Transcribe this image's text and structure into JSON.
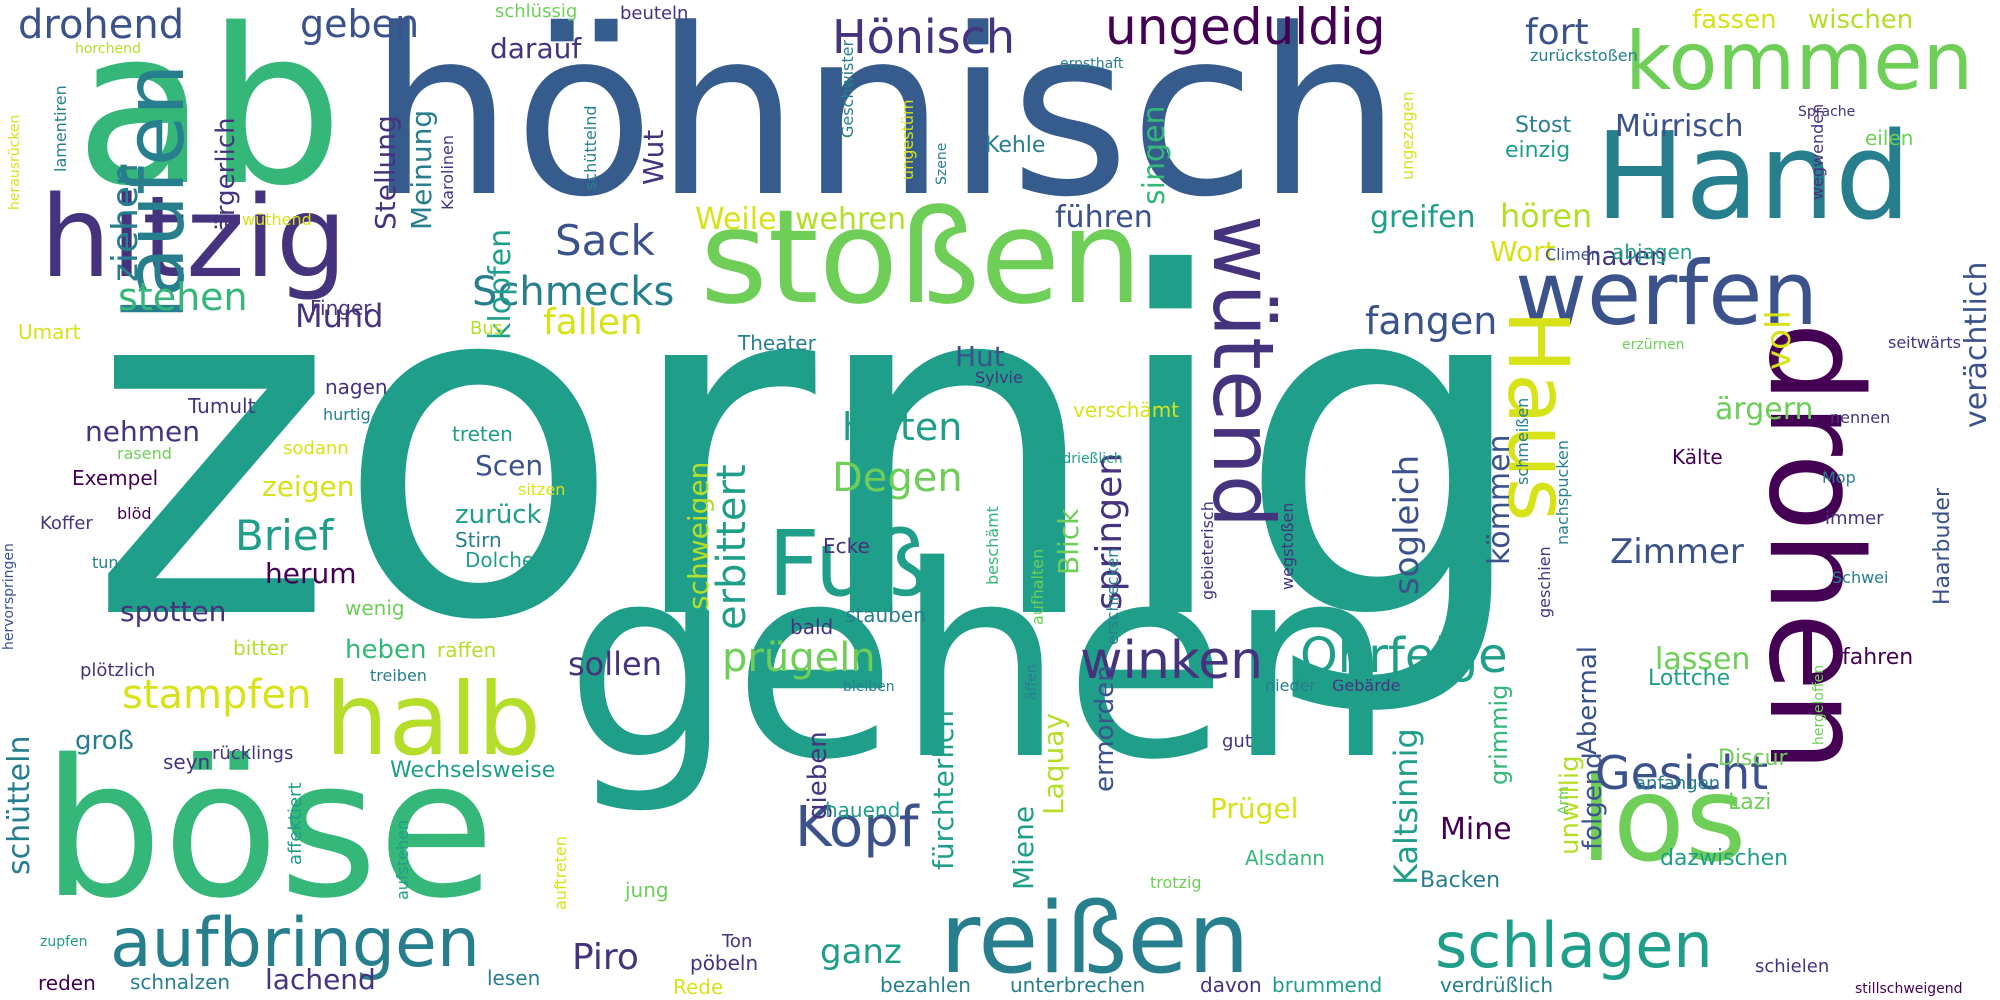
{
  "palette": {
    "deep_purple": "#440154",
    "indigo": "#46337e",
    "blue": "#365c8d",
    "steel": "#3b528b",
    "teal_blue": "#277f8e",
    "teal": "#1f9e89",
    "green": "#35b779",
    "light_green": "#6ece58",
    "lime": "#b5de2b",
    "yellow": "#d8e219"
  },
  "words": [
    {
      "text": "zornig",
      "color": "teal"
    },
    {
      "text": "gehen",
      "color": "teal"
    },
    {
      "text": "höhnisch",
      "color": "blue"
    },
    {
      "text": "ab",
      "color": "green"
    },
    {
      "text": "böse",
      "color": "green"
    },
    {
      "text": "drohen",
      "color": "deep_purple"
    },
    {
      "text": "stoßen",
      "color": "light_green"
    },
    {
      "text": "Hand",
      "color": "teal_blue"
    },
    {
      "text": "hitzig",
      "color": "indigo"
    },
    {
      "text": "los",
      "color": "light_green"
    },
    {
      "text": "reißen",
      "color": "teal_blue"
    },
    {
      "text": "Fuß",
      "color": "teal"
    },
    {
      "text": "halb",
      "color": "lime"
    },
    {
      "text": "laufen",
      "color": "teal_blue"
    },
    {
      "text": "werfen",
      "color": "steel"
    },
    {
      "text": "kommen",
      "color": "light_green"
    },
    {
      "text": "wütend",
      "color": "indigo"
    },
    {
      "text": "Haus",
      "color": "yellow"
    },
    {
      "text": "aufbringen",
      "color": "teal_blue"
    },
    {
      "text": "schlagen",
      "color": "teal"
    },
    {
      "text": "Hönisch",
      "color": "indigo"
    },
    {
      "text": "ungeduldig",
      "color": "deep_purple"
    },
    {
      "text": "Kopf",
      "color": "steel"
    },
    {
      "text": "winken",
      "color": "indigo"
    },
    {
      "text": "Ohrfeige",
      "color": "teal"
    },
    {
      "text": "Gesicht",
      "color": "steel"
    },
    {
      "text": "erbittert",
      "color": "teal"
    },
    {
      "text": "Sack",
      "color": "steel"
    },
    {
      "text": "Schmecks",
      "color": "teal_blue"
    },
    {
      "text": "prügeln",
      "color": "light_green"
    },
    {
      "text": "stampfen",
      "color": "yellow"
    },
    {
      "text": "drohend",
      "color": "steel"
    },
    {
      "text": "Degen",
      "color": "light_green"
    },
    {
      "text": "halten",
      "color": "teal"
    },
    {
      "text": "fangen",
      "color": "steel"
    },
    {
      "text": "sollen",
      "color": "indigo"
    },
    {
      "text": "Brief",
      "color": "teal"
    },
    {
      "text": "Piro",
      "color": "indigo"
    },
    {
      "text": "ganz",
      "color": "teal"
    },
    {
      "text": "springen",
      "color": "indigo"
    },
    {
      "text": "Zimmer",
      "color": "steel"
    },
    {
      "text": "sogleich",
      "color": "steel"
    },
    {
      "text": "Kaltsinnig",
      "color": "teal"
    },
    {
      "text": "kömmen",
      "color": "steel"
    },
    {
      "text": "Mürrisch",
      "color": "steel"
    },
    {
      "text": "voll",
      "color": "yellow"
    },
    {
      "text": "verächtlich",
      "color": "steel"
    },
    {
      "text": "hören",
      "color": "lime"
    },
    {
      "text": "greifen",
      "color": "teal"
    },
    {
      "text": "Mund",
      "color": "indigo"
    },
    {
      "text": "stehen",
      "color": "green"
    },
    {
      "text": "fallen",
      "color": "yellow"
    },
    {
      "text": "ziehen",
      "color": "teal_blue"
    },
    {
      "text": "geben",
      "color": "steel"
    },
    {
      "text": "fort",
      "color": "steel"
    },
    {
      "text": "fassen",
      "color": "yellow"
    },
    {
      "text": "wischen",
      "color": "lime"
    },
    {
      "text": "Weile",
      "color": "yellow"
    },
    {
      "text": "wehren",
      "color": "lime"
    },
    {
      "text": "führen",
      "color": "steel"
    },
    {
      "text": "Wut",
      "color": "indigo"
    },
    {
      "text": "darauf",
      "color": "indigo"
    },
    {
      "text": "singen",
      "color": "green"
    },
    {
      "text": "Meinung",
      "color": "teal_blue"
    },
    {
      "text": "Stellung",
      "color": "indigo"
    },
    {
      "text": "klopfen",
      "color": "teal"
    },
    {
      "text": "ärgerlich",
      "color": "indigo"
    },
    {
      "text": "Hut",
      "color": "steel"
    },
    {
      "text": "Scen",
      "color": "steel"
    },
    {
      "text": "zurück",
      "color": "teal"
    },
    {
      "text": "herum",
      "color": "deep_purple"
    },
    {
      "text": "zeigen",
      "color": "yellow"
    },
    {
      "text": "nehmen",
      "color": "indigo"
    },
    {
      "text": "spotten",
      "color": "indigo"
    },
    {
      "text": "heben",
      "color": "green"
    },
    {
      "text": "lassen",
      "color": "light_green"
    },
    {
      "text": "Lottche",
      "color": "teal"
    },
    {
      "text": "fahren",
      "color": "deep_purple"
    },
    {
      "text": "Mine",
      "color": "deep_purple"
    },
    {
      "text": "Prügel",
      "color": "yellow"
    },
    {
      "text": "ärgern",
      "color": "light_green"
    },
    {
      "text": "hauen",
      "color": "indigo"
    },
    {
      "text": "Wort",
      "color": "yellow"
    },
    {
      "text": "schütteln",
      "color": "teal_blue"
    },
    {
      "text": "groß",
      "color": "teal_blue"
    },
    {
      "text": "lachend",
      "color": "indigo"
    },
    {
      "text": "schweigen",
      "color": "lime"
    },
    {
      "text": "Blick",
      "color": "light_green"
    },
    {
      "text": "fürchterlich",
      "color": "teal"
    },
    {
      "text": "Miene",
      "color": "teal"
    },
    {
      "text": "Laquay",
      "color": "lime"
    },
    {
      "text": "gieben",
      "color": "indigo"
    },
    {
      "text": "ermorden",
      "color": "steel"
    },
    {
      "text": "grimmig",
      "color": "green"
    },
    {
      "text": "Abermal",
      "color": "steel"
    },
    {
      "text": "unwillig",
      "color": "lime"
    },
    {
      "text": "folgend",
      "color": "steel"
    },
    {
      "text": "Wechselsweise",
      "color": "teal"
    },
    {
      "text": "Backen",
      "color": "teal_blue"
    },
    {
      "text": "Alsdann",
      "color": "green"
    },
    {
      "text": "dazwischen",
      "color": "teal"
    },
    {
      "text": "Discur",
      "color": "light_green"
    },
    {
      "text": "Lazi",
      "color": "light_green"
    },
    {
      "text": "Haarbuder",
      "color": "steel"
    },
    {
      "text": "Stost",
      "color": "teal_blue"
    },
    {
      "text": "einzig",
      "color": "teal"
    },
    {
      "text": "Kehle",
      "color": "teal_blue"
    },
    {
      "text": "Finger",
      "color": "indigo"
    },
    {
      "text": "Umart",
      "color": "yellow"
    },
    {
      "text": "Bus",
      "color": "lime"
    },
    {
      "text": "Theater",
      "color": "teal_blue"
    },
    {
      "text": "verschämt",
      "color": "yellow"
    },
    {
      "text": "Tumult",
      "color": "indigo"
    },
    {
      "text": "nagen",
      "color": "indigo"
    },
    {
      "text": "hurtig",
      "color": "teal_blue"
    },
    {
      "text": "treten",
      "color": "teal"
    },
    {
      "text": "sodann",
      "color": "yellow"
    },
    {
      "text": "Exempel",
      "color": "deep_purple"
    },
    {
      "text": "rasend",
      "color": "light_green"
    },
    {
      "text": "sitzen",
      "color": "yellow"
    },
    {
      "text": "Stirn",
      "color": "teal_blue"
    },
    {
      "text": "Dolche",
      "color": "teal"
    },
    {
      "text": "Ecke",
      "color": "indigo"
    },
    {
      "text": "stauben",
      "color": "teal_blue"
    },
    {
      "text": "bald",
      "color": "indigo"
    },
    {
      "text": "Koffer",
      "color": "indigo"
    },
    {
      "text": "blöd",
      "color": "deep_purple"
    },
    {
      "text": "tun",
      "color": "teal_blue"
    },
    {
      "text": "wenig",
      "color": "light_green"
    },
    {
      "text": "bitter",
      "color": "lime"
    },
    {
      "text": "raffen",
      "color": "lime"
    },
    {
      "text": "plötzlich",
      "color": "indigo"
    },
    {
      "text": "treiben",
      "color": "teal_blue"
    },
    {
      "text": "rücklings",
      "color": "indigo"
    },
    {
      "text": "seyn",
      "color": "indigo"
    },
    {
      "text": "reden",
      "color": "deep_purple"
    },
    {
      "text": "schnalzen",
      "color": "teal_blue"
    },
    {
      "text": "lesen",
      "color": "teal_blue"
    },
    {
      "text": "Rede",
      "color": "yellow"
    },
    {
      "text": "Ton",
      "color": "indigo"
    },
    {
      "text": "pöbeln",
      "color": "indigo"
    },
    {
      "text": "jung",
      "color": "light_green"
    },
    {
      "text": "hauend",
      "color": "teal"
    },
    {
      "text": "bezahlen",
      "color": "teal_blue"
    },
    {
      "text": "unterbrechen",
      "color": "teal_blue"
    },
    {
      "text": "davon",
      "color": "indigo"
    },
    {
      "text": "brummend",
      "color": "teal"
    },
    {
      "text": "verdrüßlich",
      "color": "teal_blue"
    },
    {
      "text": "schielen",
      "color": "indigo"
    },
    {
      "text": "stillschweigend",
      "color": "deep_purple"
    },
    {
      "text": "trotzig",
      "color": "light_green"
    },
    {
      "text": "gut",
      "color": "indigo"
    },
    {
      "text": "nieder",
      "color": "teal_blue"
    },
    {
      "text": "Gebärde",
      "color": "indigo"
    },
    {
      "text": "anfangen",
      "color": "teal_blue"
    },
    {
      "text": "Kälte",
      "color": "deep_purple"
    },
    {
      "text": "Mop",
      "color": "teal_blue"
    },
    {
      "text": "immer",
      "color": "indigo"
    },
    {
      "text": "nennen",
      "color": "indigo"
    },
    {
      "text": "Schwei",
      "color": "teal_blue"
    },
    {
      "text": "Sylvie",
      "color": "indigo"
    },
    {
      "text": "verdrießlich",
      "color": "teal"
    },
    {
      "text": "erzürnen",
      "color": "light_green"
    },
    {
      "text": "seitwärts",
      "color": "indigo"
    },
    {
      "text": "abjagen",
      "color": "teal"
    },
    {
      "text": "Climen",
      "color": "steel"
    },
    {
      "text": "eilen",
      "color": "light_green"
    },
    {
      "text": "Sprache",
      "color": "indigo"
    },
    {
      "text": "schlüssig",
      "color": "light_green"
    },
    {
      "text": "beuteln",
      "color": "indigo"
    },
    {
      "text": "Geschwister",
      "color": "teal_blue"
    },
    {
      "text": "ernsthaft",
      "color": "teal_blue"
    },
    {
      "text": "zurückstoßen",
      "color": "teal_blue"
    },
    {
      "text": "horchend",
      "color": "lime"
    },
    {
      "text": "wüthend",
      "color": "yellow"
    },
    {
      "text": "Karolinen",
      "color": "indigo"
    },
    {
      "text": "schüttelnd",
      "color": "teal_blue"
    },
    {
      "text": "ungestüm",
      "color": "yellow"
    },
    {
      "text": "Szene",
      "color": "teal_blue"
    },
    {
      "text": "ungezogen",
      "color": "yellow"
    },
    {
      "text": "wegwenden",
      "color": "indigo"
    },
    {
      "text": "herausrücken",
      "color": "yellow"
    },
    {
      "text": "lamentiren",
      "color": "teal_blue"
    },
    {
      "text": "hervorspringen",
      "color": "steel"
    },
    {
      "text": "affektiert",
      "color": "teal"
    },
    {
      "text": "aufstehen",
      "color": "teal"
    },
    {
      "text": "auftreten",
      "color": "yellow"
    },
    {
      "text": "aufhalten",
      "color": "light_green"
    },
    {
      "text": "beschämt",
      "color": "green"
    },
    {
      "text": "erschrecken",
      "color": "teal_blue"
    },
    {
      "text": "gebieterisch",
      "color": "indigo"
    },
    {
      "text": "wegstoßen",
      "color": "indigo"
    },
    {
      "text": "schmeißen",
      "color": "teal_blue"
    },
    {
      "text": "geschien",
      "color": "indigo"
    },
    {
      "text": "nachspucken",
      "color": "teal_blue"
    },
    {
      "text": "Arm",
      "color": "light_green"
    },
    {
      "text": "hergeloffen",
      "color": "light_green"
    },
    {
      "text": "äffen",
      "color": "teal_blue"
    },
    {
      "text": "bleiben",
      "color": "teal_blue"
    },
    {
      "text": "zupfen",
      "color": "teal"
    }
  ]
}
